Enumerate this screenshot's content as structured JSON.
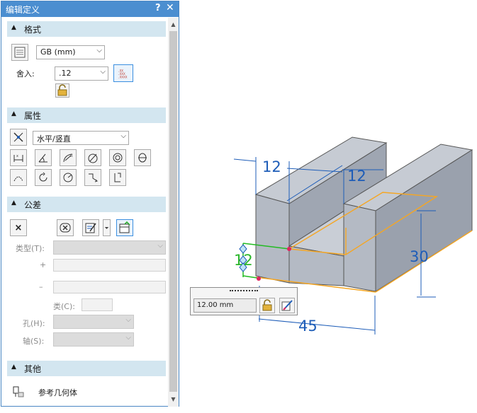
{
  "dialog": {
    "title": "编辑定义",
    "help": "?",
    "close": "✕"
  },
  "format": {
    "header": "格式",
    "standard": "GB (mm)",
    "rounding_label": "舍入:",
    "rounding_value": ".12",
    "precision_icon_text": ".XX .XXX .XXXX"
  },
  "attributes": {
    "header": "属性",
    "orientation": "水平/竖直"
  },
  "tolerance": {
    "header": "公差",
    "clear_button": "×",
    "type_label": "类型(T):",
    "plus_label": "+",
    "minus_label": "–",
    "class_label": "类(C):",
    "hole_label": "孔(H):",
    "shaft_label": "轴(S):"
  },
  "other": {
    "header": "其他",
    "ref_geometry_label": "参考几何体"
  },
  "viewport": {
    "dim_width_left": "12",
    "dim_width_right": "12",
    "dim_height": "30",
    "dim_length": "45",
    "dim_selected": "12",
    "dim_edit_value": "12.00 mm"
  },
  "colors": {
    "title_bar": "#4b8ed0",
    "section_header": "#d3e6f0",
    "dimension": "#1e5db8",
    "selected_dimension": "#22bb22",
    "highlight_edge": "#f5a623",
    "model_face": "#a9b0bd"
  }
}
